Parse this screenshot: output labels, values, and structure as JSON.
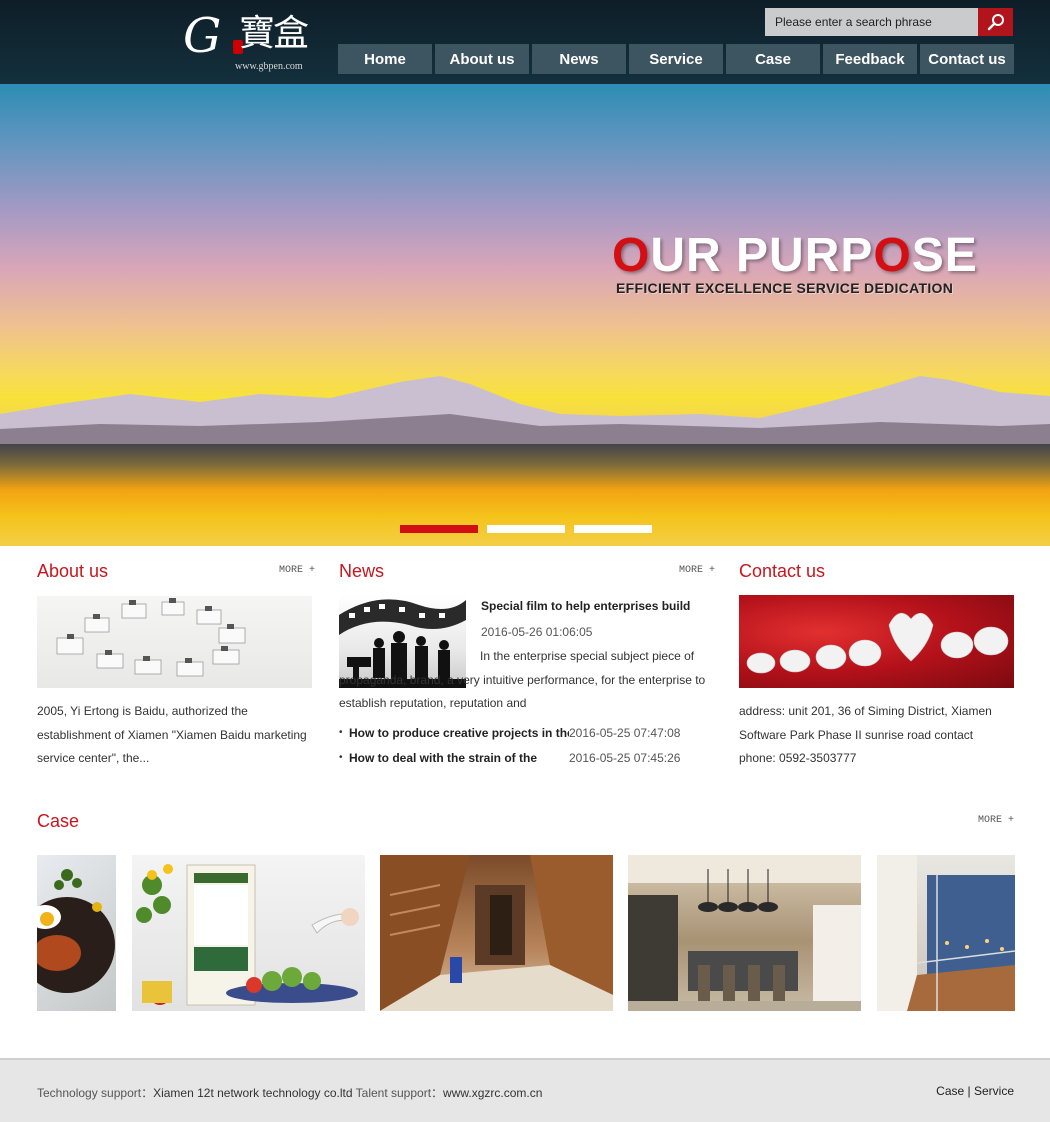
{
  "header": {
    "logo": {
      "mark": "G",
      "chinese": "寶盒",
      "url": "www.gbpen.com"
    },
    "search": {
      "placeholder": "Please enter a search phrase"
    },
    "nav": [
      "Home",
      "About us",
      "News",
      "Service",
      "Case",
      "Feedback",
      "Contact us"
    ]
  },
  "banner": {
    "title_parts": [
      "O",
      "UR PURP",
      "O",
      "SE"
    ],
    "subtitle": "EFFICIENT EXCELLENCE SERVICE DEDICATION",
    "slides_total": 3,
    "active_slide": 1
  },
  "about": {
    "title": "About us",
    "more": "MORE +",
    "text": "2005, Yi Ertong is Baidu, authorized the establishment of Xiamen \"Xiamen Baidu marketing service center\", the..."
  },
  "news": {
    "title": "News",
    "more": "MORE +",
    "featured": {
      "title": "Special film to help enterprises build",
      "date": "2016-05-26 01:06:05",
      "summary": "In the enterprise special subject piece of propaganda, brand, a very intuitive performance, for the enterprise to establish reputation, reputation and"
    },
    "items": [
      {
        "title": "How to produce creative projects in the",
        "date": "2016-05-25 07:47:08"
      },
      {
        "title": "How to deal with the strain of the",
        "date": "2016-05-25 07:45:26"
      }
    ]
  },
  "contact": {
    "title": "Contact us",
    "address": "address: unit 201, 36 of Siming District, Xiamen Software Park Phase II sunrise road contact",
    "phone": "phone: 0592-3503777"
  },
  "case": {
    "title": "Case",
    "more": "MORE +"
  },
  "footer": {
    "tech_label": "Technology support：",
    "tech_value": "Xiamen 12t network technology co.ltd",
    "talent_label": "Talent support：",
    "talent_value": "www.xgzrc.com.cn",
    "links": [
      "Case",
      "Service"
    ],
    "separator": "|"
  },
  "colors": {
    "brand_red": "#c8161d",
    "header_bg": "#13303d",
    "nav_bg": "#3d5561",
    "search_btn": "#b2141b"
  }
}
